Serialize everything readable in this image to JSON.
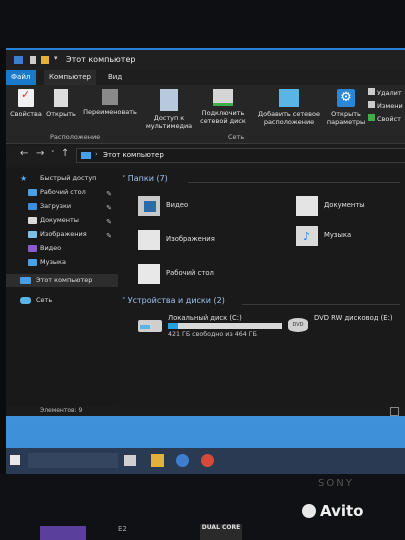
{
  "window": {
    "title": "Этот компьютер",
    "tabs": [
      "Файл",
      "Компьютер",
      "Вид"
    ]
  },
  "ribbon": {
    "buttons": [
      "Свойства",
      "Открыть",
      "Переименовать",
      "Доступ к мультимедиа",
      "Подключить сетевой диск",
      "Добавить сетевое расположение",
      "Открыть параметры"
    ],
    "small_buttons": [
      "Удалит",
      "Измени",
      "Свойст"
    ],
    "groups": [
      "Расположение",
      "Сеть"
    ]
  },
  "navbar": {
    "path": "Этот компьютер"
  },
  "sidebar": {
    "items": [
      {
        "label": "Быстрый доступ",
        "icon": "star-icon",
        "pinned": false
      },
      {
        "label": "Рабочий стол",
        "icon": "desktop-folder-icon",
        "pinned": true
      },
      {
        "label": "Загрузки",
        "icon": "downloads-icon",
        "pinned": true
      },
      {
        "label": "Документы",
        "icon": "documents-icon",
        "pinned": true
      },
      {
        "label": "Изображения",
        "icon": "pictures-icon",
        "pinned": true
      },
      {
        "label": "Видео",
        "icon": "videos-icon",
        "pinned": false
      },
      {
        "label": "Музыка",
        "icon": "music-icon",
        "pinned": false
      },
      {
        "label": "Этот компьютер",
        "icon": "computer-icon",
        "pinned": false
      },
      {
        "label": "Сеть",
        "icon": "network-icon",
        "pinned": false
      }
    ]
  },
  "content": {
    "folders_header": "Папки (7)",
    "folders": [
      "Видео",
      "Документы",
      "Изображения",
      "Музыка",
      "Рабочий стол"
    ],
    "drives_header": "Устройства и диски (2)",
    "drives": [
      {
        "name": "Локальный диск (C:)",
        "info": "421 ГБ свободно из 464 ГБ",
        "used_fraction": 0.09
      },
      {
        "name": "DVD RW дисковод (E:)",
        "info": "",
        "used_fraction": null
      }
    ]
  },
  "status": {
    "items": "Элементов: 9"
  },
  "bottom": {
    "sony": "SONY",
    "avito": "Avito",
    "sticker1": "E2",
    "sticker2": "DUAL CORE"
  }
}
